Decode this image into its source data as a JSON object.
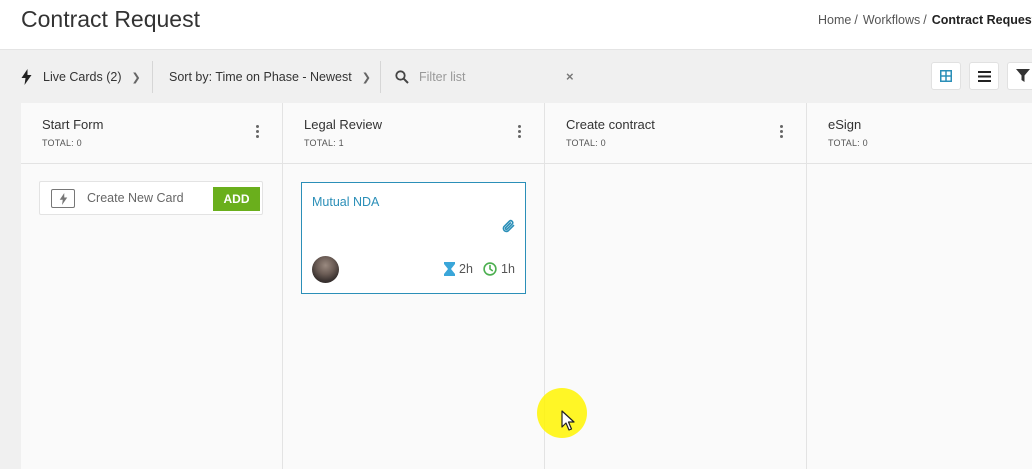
{
  "header": {
    "title": "Contract Request",
    "breadcrumb": [
      {
        "label": "Home"
      },
      {
        "label": "Workflows"
      },
      {
        "label": "Contract Request"
      }
    ],
    "separator": "/"
  },
  "toolbar": {
    "live_cards": "Live Cards (2)",
    "sort_by": "Sort by: Time on Phase - Newest",
    "filter_placeholder": "Filter list",
    "clear": "×"
  },
  "view_buttons": [
    "grid-view",
    "list-view",
    "filter"
  ],
  "columns": [
    {
      "title": "Start Form",
      "total": "TOTAL: 0"
    },
    {
      "title": "Legal Review",
      "total": "TOTAL: 1"
    },
    {
      "title": "Create contract",
      "total": "TOTAL: 0"
    },
    {
      "title": "eSign",
      "total": "TOTAL: 0"
    }
  ],
  "create_card": {
    "label": "Create New Card",
    "button": "ADD"
  },
  "cards": [
    {
      "title": "Mutual NDA",
      "time_in_phase": "2h",
      "time_total": "1h",
      "has_attachment": true
    }
  ],
  "colors": {
    "accent": "#2b8fb8",
    "add_button": "#6aaf1c",
    "hourglass": "#3aa6d9",
    "clock": "#4caf50"
  }
}
